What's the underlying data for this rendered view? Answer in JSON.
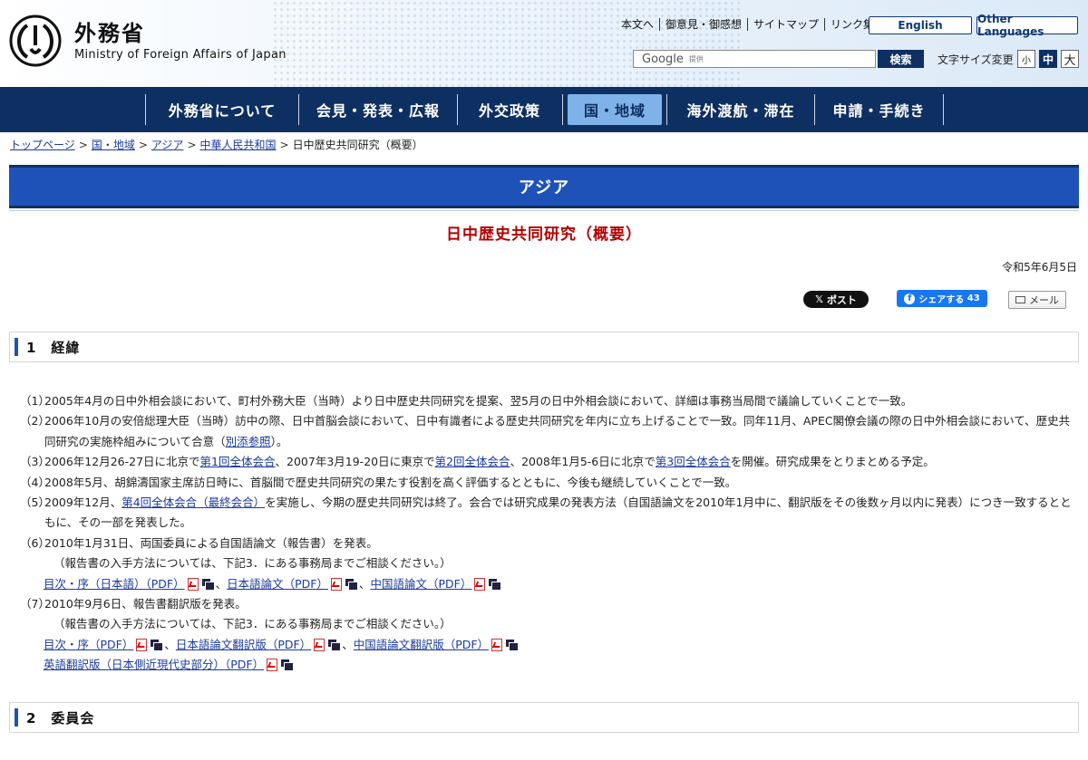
{
  "header": {
    "logo_ja": "外務省",
    "logo_en": "Ministry of Foreign Affairs of Japan",
    "util_links": [
      "本文へ",
      "御意見・御感想",
      "サイトマップ",
      "リンク集"
    ],
    "english_label": "English",
    "other_languages_label": "Other Languages",
    "search_placeholder_brand": "Google",
    "search_placeholder_suffix": "提供",
    "search_button": "検索",
    "font_size_label": "文字サイズ変更",
    "font_small": "小",
    "font_medium": "中",
    "font_large": "大"
  },
  "nav": {
    "items": [
      "外務省について",
      "会見・発表・広報",
      "外交政策",
      "国・地域",
      "海外渡航・滞在",
      "申請・手続き"
    ],
    "active": "国・地域"
  },
  "breadcrumb": {
    "items": [
      "トップページ",
      "国・地域",
      "アジア",
      "中華人民共和国"
    ],
    "current": "日中歴史共同研究（概要）"
  },
  "section_banner": "アジア",
  "page_title": "日中歴史共同研究（概要）",
  "date": "令和5年6月5日",
  "share": {
    "x_label": "ポスト",
    "fb_label": "シェアする",
    "fb_count": "43",
    "mail_label": "メール"
  },
  "sections": {
    "s1": "1　経緯",
    "s2": "2　委員会"
  },
  "items": {
    "i1_num": "（1）",
    "i1": "2005年4月の日中外相会談において、町村外務大臣（当時）より日中歴史共同研究を提案、翌5月の日中外相会談において、詳細は事務当局間で議論していくことで一致。",
    "i2_num": "（2）",
    "i2_a": "2006年10月の安倍総理大臣（当時）訪中の際、日中首脳会談において、日中有識者による歴史共同研究を年内に立ち上げることで一致。同年11月、APEC閣僚会議の際の日中外相会談において、歴史共同研究の実施枠組みについて合意（",
    "i2_link": "別添参照",
    "i2_b": "）。",
    "i3_num": "（3）",
    "i3_a": "2006年12月26-27日に北京で",
    "i3_link1": "第1回全体会合",
    "i3_b": "、2007年3月19-20日に東京で",
    "i3_link2": "第2回全体会合",
    "i3_c": "、2008年1月5-6日に北京で",
    "i3_link3": "第3回全体会合",
    "i3_d": "を開催。研究成果をとりまとめる予定。",
    "i4_num": "（4）",
    "i4": "2008年5月、胡錦濤国家主席訪日時に、首脳間で歴史共同研究の果たす役割を高く評価するとともに、今後も継続していくことで一致。",
    "i5_num": "（5）",
    "i5_a": "2009年12月、",
    "i5_link": "第4回全体会合（最終会合）",
    "i5_b": "を実施し、今期の歴史共同研究は終了。会合では研究成果の発表方法（自国語論文を2010年1月中に、翻訳版をその後数ヶ月以内に発表）につき一致するとともに、その一部を発表した。",
    "i6_num": "（6）",
    "i6": "2010年1月31日、両国委員による自国語論文（報告書）を発表。",
    "i6_note": "（報告書の入手方法については、下記3．にある事務局までご相談ください。）",
    "i6_link1": "目次・序（日本語）（PDF）",
    "i6_link2": "日本語論文（PDF）",
    "i6_link3": "中国語論文（PDF）",
    "i7_num": "（7）",
    "i7": "2010年9月6日、報告書翻訳版を発表。",
    "i7_note": "（報告書の入手方法については、下記3．にある事務局までご相談ください。）",
    "i7_link1": "目次・序（PDF）",
    "i7_link2": "日本語論文翻訳版（PDF）",
    "i7_link3": "中国語論文翻訳版（PDF）",
    "i7_link4": "英語翻訳版（日本側近現代史部分）（PDF）",
    "comma": "、"
  }
}
